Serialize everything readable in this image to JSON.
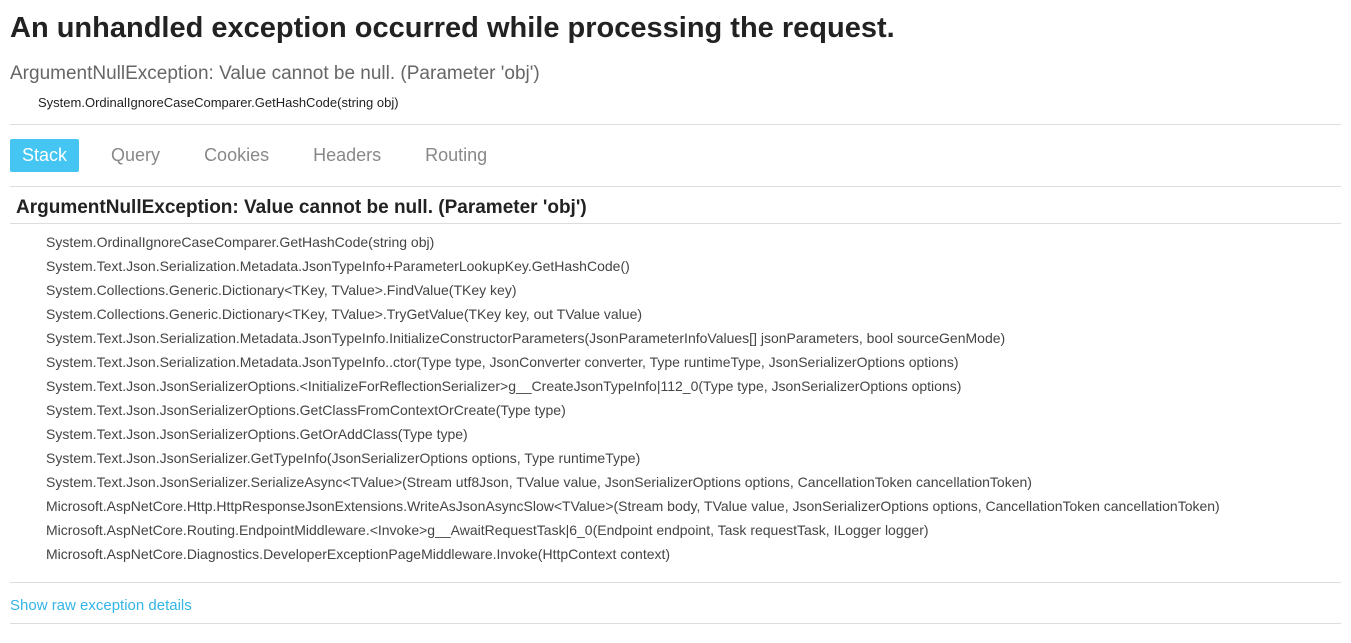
{
  "title": "An unhandled exception occurred while processing the request.",
  "summary": "ArgumentNullException: Value cannot be null. (Parameter 'obj')",
  "source": "System.OrdinalIgnoreCaseComparer.GetHashCode(string obj)",
  "tabs": {
    "stack": "Stack",
    "query": "Query",
    "cookies": "Cookies",
    "headers": "Headers",
    "routing": "Routing"
  },
  "stackTitle": "ArgumentNullException: Value cannot be null. (Parameter 'obj')",
  "frames": [
    "System.OrdinalIgnoreCaseComparer.GetHashCode(string obj)",
    "System.Text.Json.Serialization.Metadata.JsonTypeInfo+ParameterLookupKey.GetHashCode()",
    "System.Collections.Generic.Dictionary<TKey, TValue>.FindValue(TKey key)",
    "System.Collections.Generic.Dictionary<TKey, TValue>.TryGetValue(TKey key, out TValue value)",
    "System.Text.Json.Serialization.Metadata.JsonTypeInfo.InitializeConstructorParameters(JsonParameterInfoValues[] jsonParameters, bool sourceGenMode)",
    "System.Text.Json.Serialization.Metadata.JsonTypeInfo..ctor(Type type, JsonConverter converter, Type runtimeType, JsonSerializerOptions options)",
    "System.Text.Json.JsonSerializerOptions.<InitializeForReflectionSerializer>g__CreateJsonTypeInfo|112_0(Type type, JsonSerializerOptions options)",
    "System.Text.Json.JsonSerializerOptions.GetClassFromContextOrCreate(Type type)",
    "System.Text.Json.JsonSerializerOptions.GetOrAddClass(Type type)",
    "System.Text.Json.JsonSerializer.GetTypeInfo(JsonSerializerOptions options, Type runtimeType)",
    "System.Text.Json.JsonSerializer.SerializeAsync<TValue>(Stream utf8Json, TValue value, JsonSerializerOptions options, CancellationToken cancellationToken)",
    "Microsoft.AspNetCore.Http.HttpResponseJsonExtensions.WriteAsJsonAsyncSlow<TValue>(Stream body, TValue value, JsonSerializerOptions options, CancellationToken cancellationToken)",
    "Microsoft.AspNetCore.Routing.EndpointMiddleware.<Invoke>g__AwaitRequestTask|6_0(Endpoint endpoint, Task requestTask, ILogger logger)",
    "Microsoft.AspNetCore.Diagnostics.DeveloperExceptionPageMiddleware.Invoke(HttpContext context)"
  ],
  "rawLink": "Show raw exception details"
}
